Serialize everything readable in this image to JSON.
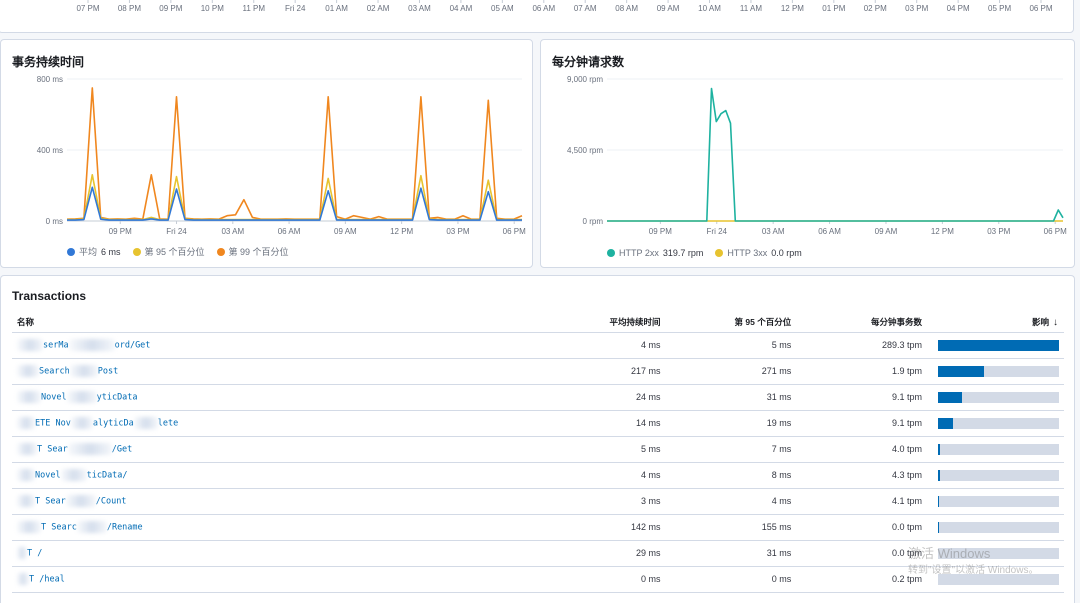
{
  "top_strip": {
    "ticks": [
      "07 PM",
      "08 PM",
      "09 PM",
      "10 PM",
      "11 PM",
      "Fri 24",
      "01 AM",
      "02 AM",
      "03 AM",
      "04 AM",
      "05 AM",
      "06 AM",
      "07 AM",
      "08 AM",
      "09 AM",
      "10 AM",
      "11 AM",
      "12 PM",
      "01 PM",
      "02 PM",
      "03 PM",
      "04 PM",
      "05 PM",
      "06 PM"
    ]
  },
  "latency": {
    "title": "事务持续时间",
    "y_ticks": [
      "800 ms",
      "400 ms",
      "0 ms"
    ],
    "x_ticks": [
      "09 PM",
      "Fri 24",
      "03 AM",
      "06 AM",
      "09 AM",
      "12 PM",
      "03 PM",
      "06 PM"
    ],
    "legend": [
      {
        "label": "平均",
        "value": "6 ms",
        "color": "#3178d6"
      },
      {
        "label": "第 95 个百分位",
        "value": "",
        "color": "#e7c32f"
      },
      {
        "label": "第 99 个百分位",
        "value": "",
        "color": "#f0871f"
      }
    ]
  },
  "rpm": {
    "title": "每分钟请求数",
    "y_ticks": [
      "9,000 rpm",
      "4,500 rpm",
      "0 rpm"
    ],
    "x_ticks": [
      "09 PM",
      "Fri 24",
      "03 AM",
      "06 AM",
      "09 AM",
      "12 PM",
      "03 PM",
      "06 PM"
    ],
    "legend": [
      {
        "label": "HTTP 2xx",
        "value": "319.7 rpm",
        "color": "#1eb2a0"
      },
      {
        "label": "HTTP 3xx",
        "value": "0.0 rpm",
        "color": "#e7c32f"
      }
    ]
  },
  "chart_data": [
    {
      "type": "line",
      "title": "事务持续时间",
      "ylim": [
        0,
        800
      ],
      "x_ticks": [
        "09 PM",
        "Fri 24",
        "03 AM",
        "06 AM",
        "09 AM",
        "12 PM",
        "03 PM",
        "06 PM"
      ],
      "series": [
        {
          "name": "平均",
          "color": "#3178d6",
          "values": [
            5,
            5,
            8,
            190,
            10,
            5,
            5,
            5,
            5,
            5,
            12,
            5,
            5,
            180,
            8,
            5,
            5,
            5,
            5,
            5,
            5,
            5,
            5,
            5,
            5,
            5,
            5,
            5,
            5,
            5,
            5,
            170,
            6,
            5,
            5,
            5,
            5,
            5,
            5,
            5,
            5,
            5,
            185,
            8,
            5,
            5,
            5,
            5,
            5,
            5,
            165,
            5,
            5,
            5,
            5
          ]
        },
        {
          "name": "第 95 个百分位",
          "color": "#e7c32f",
          "values": [
            8,
            8,
            12,
            260,
            15,
            8,
            8,
            8,
            8,
            8,
            20,
            8,
            8,
            250,
            12,
            8,
            8,
            8,
            8,
            8,
            8,
            8,
            8,
            8,
            8,
            8,
            8,
            8,
            8,
            8,
            8,
            240,
            9,
            8,
            8,
            8,
            8,
            8,
            8,
            8,
            8,
            8,
            255,
            12,
            8,
            8,
            8,
            8,
            8,
            8,
            230,
            8,
            8,
            8,
            8
          ]
        },
        {
          "name": "第 99 个百分位",
          "color": "#f0871f",
          "values": [
            10,
            12,
            15,
            750,
            20,
            10,
            12,
            10,
            15,
            10,
            260,
            12,
            10,
            700,
            15,
            12,
            10,
            12,
            10,
            30,
            35,
            120,
            20,
            10,
            10,
            10,
            12,
            10,
            10,
            10,
            10,
            700,
            25,
            10,
            30,
            20,
            10,
            25,
            10,
            10,
            10,
            10,
            700,
            15,
            20,
            10,
            10,
            30,
            10,
            10,
            680,
            15,
            10,
            10,
            30
          ]
        }
      ]
    },
    {
      "type": "line",
      "title": "每分钟请求数",
      "ylim": [
        0,
        9000
      ],
      "x_ticks": [
        "09 PM",
        "Fri 24",
        "03 AM",
        "06 AM",
        "09 AM",
        "12 PM",
        "03 PM",
        "06 PM"
      ],
      "series": [
        {
          "name": "HTTP 2xx",
          "color": "#1eb2a0",
          "values": [
            0,
            0,
            0,
            0,
            0,
            0,
            0,
            0,
            0,
            0,
            0,
            0,
            0,
            0,
            0,
            0,
            0,
            0,
            0,
            0,
            0,
            0,
            8400,
            6300,
            6800,
            7000,
            6200,
            0,
            0,
            0,
            0,
            0,
            0,
            0,
            0,
            0,
            0,
            0,
            0,
            0,
            0,
            0,
            0,
            0,
            0,
            0,
            0,
            0,
            0,
            0,
            0,
            0,
            0,
            0,
            0,
            0,
            0,
            0,
            0,
            0,
            0,
            0,
            0,
            0,
            0,
            0,
            0,
            0,
            0,
            0,
            0,
            0,
            0,
            0,
            0,
            0,
            0,
            0,
            0,
            0,
            0,
            0,
            0,
            0,
            0,
            0,
            0,
            0,
            0,
            0,
            0,
            0,
            0,
            0,
            0,
            700,
            200
          ]
        },
        {
          "name": "HTTP 3xx",
          "color": "#e7c32f",
          "values": [
            0,
            0,
            0,
            0,
            0,
            0,
            0,
            0,
            0,
            0,
            0,
            0,
            0,
            0,
            0,
            0,
            0,
            0,
            0,
            0,
            0,
            0,
            0,
            0,
            0,
            0,
            0,
            0,
            0,
            0,
            0,
            0,
            0,
            0,
            0,
            0,
            0,
            0,
            0,
            0,
            0,
            0,
            0,
            0,
            0,
            0,
            0,
            0,
            0,
            0,
            0,
            0,
            0,
            0,
            0,
            0,
            0,
            0,
            0,
            0,
            0,
            0,
            0,
            0,
            0,
            0,
            0,
            0,
            0,
            0,
            0,
            0,
            0,
            0,
            0,
            0,
            0,
            0,
            0,
            0,
            0,
            0,
            0,
            0,
            0,
            0,
            0,
            0,
            0,
            0,
            0,
            0,
            0,
            0,
            0
          ]
        }
      ]
    }
  ],
  "transactions": {
    "title": "Transactions",
    "columns": {
      "name": "名称",
      "avg": "平均持续时间",
      "p95": "第 95 个百分位",
      "tpm": "每分钟事务数",
      "impact": "影响"
    },
    "rows": [
      {
        "name": "serMa",
        "name_tail": "ord/Get",
        "avg": "4 ms",
        "p95": "5 ms",
        "tpm": "289.3 tpm",
        "impact": 1.0
      },
      {
        "name": "Search",
        "name_tail": "Post",
        "avg": "217 ms",
        "p95": "271 ms",
        "tpm": "1.9 tpm",
        "impact": 0.38
      },
      {
        "name": "Novel",
        "name_tail": "yticData",
        "avg": "24 ms",
        "p95": "31 ms",
        "tpm": "9.1 tpm",
        "impact": 0.2
      },
      {
        "name": "ETE Nov",
        "name_tail": "alyticDa",
        "name_tail2": "lete",
        "avg": "14 ms",
        "p95": "19 ms",
        "tpm": "9.1 tpm",
        "impact": 0.12
      },
      {
        "name": "T Sear",
        "name_tail": "/Get",
        "avg": "5 ms",
        "p95": "7 ms",
        "tpm": "4.0 tpm",
        "impact": 0.02
      },
      {
        "name": "Novel",
        "name_tail": "ticData/",
        "avg": "4 ms",
        "p95": "8 ms",
        "tpm": "4.3 tpm",
        "impact": 0.02
      },
      {
        "name": "T Sear",
        "name_tail": "/Count",
        "avg": "3 ms",
        "p95": "4 ms",
        "tpm": "4.1 tpm",
        "impact": 0.01
      },
      {
        "name": "T Searc",
        "name_tail": "/Rename",
        "avg": "142 ms",
        "p95": "155 ms",
        "tpm": "0.0 tpm",
        "impact": 0.005
      },
      {
        "name": "T /",
        "name_tail": "",
        "avg": "29 ms",
        "p95": "31 ms",
        "tpm": "0.0 tpm",
        "impact": 0.0
      },
      {
        "name": "T /heal",
        "name_tail": "",
        "avg": "0 ms",
        "p95": "0 ms",
        "tpm": "0.2 tpm",
        "impact": 0.0
      }
    ]
  },
  "watermark": {
    "line1": "激活 Windows",
    "line2": "转到\"设置\"以激活 Windows。"
  }
}
